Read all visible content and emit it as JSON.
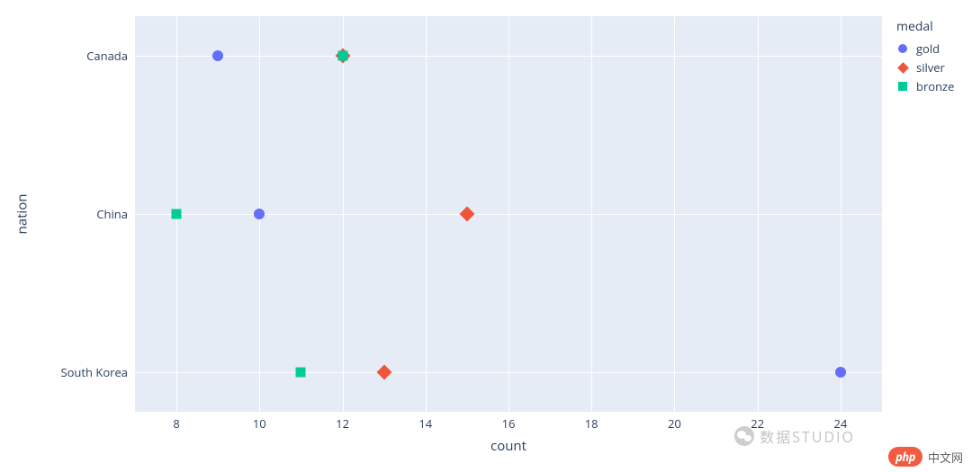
{
  "chart_data": {
    "type": "scatter",
    "xlabel": "count",
    "ylabel": "nation",
    "xlim": [
      7,
      25
    ],
    "y_categories": [
      "Canada",
      "China",
      "South Korea"
    ],
    "x_ticks": [
      8,
      10,
      12,
      14,
      16,
      18,
      20,
      22,
      24
    ],
    "series": [
      {
        "name": "gold",
        "symbol": "circle",
        "color": "#636efa",
        "points": [
          {
            "nation": "Canada",
            "count": 9
          },
          {
            "nation": "China",
            "count": 10
          },
          {
            "nation": "South Korea",
            "count": 24
          }
        ]
      },
      {
        "name": "silver",
        "symbol": "diamond",
        "color": "#ef553b",
        "points": [
          {
            "nation": "Canada",
            "count": 12
          },
          {
            "nation": "China",
            "count": 15
          },
          {
            "nation": "South Korea",
            "count": 13
          }
        ]
      },
      {
        "name": "bronze",
        "symbol": "square",
        "color": "#00cc96",
        "points": [
          {
            "nation": "Canada",
            "count": 12
          },
          {
            "nation": "China",
            "count": 8
          },
          {
            "nation": "South Korea",
            "count": 11
          }
        ]
      }
    ],
    "legend_title": "medal"
  },
  "legend": {
    "title": "medal",
    "items": [
      {
        "label": "gold"
      },
      {
        "label": "silver"
      },
      {
        "label": "bronze"
      }
    ]
  },
  "axis": {
    "x": "count",
    "y": "nation",
    "xticks": {
      "t0": "8",
      "t1": "10",
      "t2": "12",
      "t3": "14",
      "t4": "16",
      "t5": "18",
      "t6": "20",
      "t7": "22",
      "t8": "24"
    },
    "yticks": {
      "c0": "Canada",
      "c1": "China",
      "c2": "South Korea"
    }
  },
  "watermark": {
    "php": "php",
    "cn": "中文网",
    "studio": "数据STUDIO"
  }
}
